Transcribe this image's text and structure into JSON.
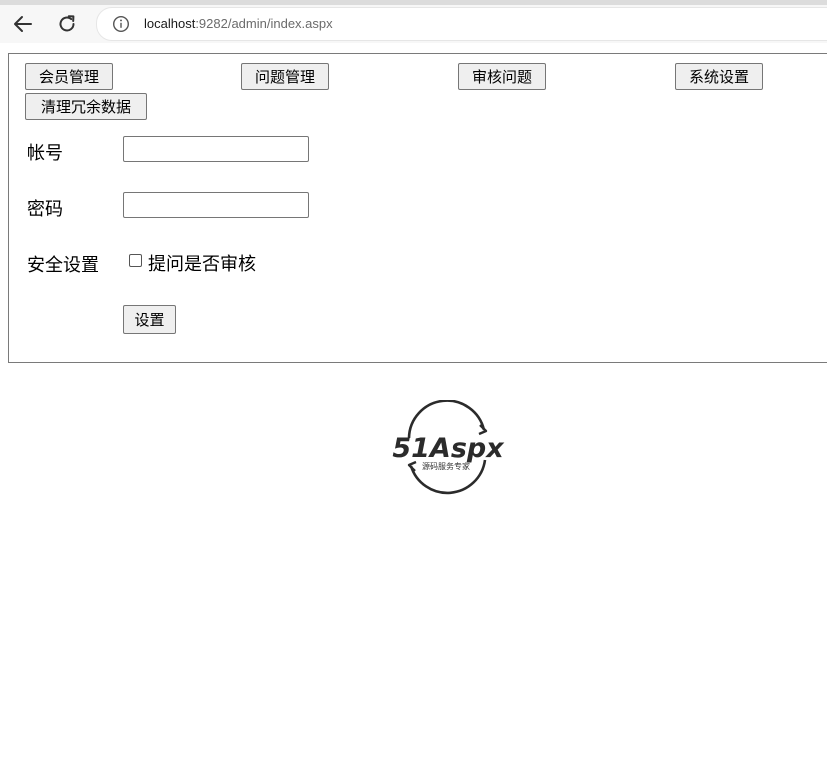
{
  "browser": {
    "url_host": "localhost",
    "url_rest": ":9282/admin/index.aspx"
  },
  "menu": {
    "members": "会员管理",
    "questions": "问题管理",
    "review": "审核问题",
    "system": "系统设置",
    "cleanup": "清理冗余数据"
  },
  "form": {
    "account_label": "帐号",
    "account_value": "",
    "password_label": "密码",
    "password_value": "",
    "security_label": "安全设置",
    "review_checkbox_label": "提问是否审核",
    "review_checked": false,
    "submit_label": "设置"
  },
  "logo": {
    "brand": "51Aspx",
    "tagline": "源码服务专家"
  },
  "icons": {
    "back": "back-arrow-icon",
    "reload": "reload-icon",
    "info": "info-icon"
  }
}
